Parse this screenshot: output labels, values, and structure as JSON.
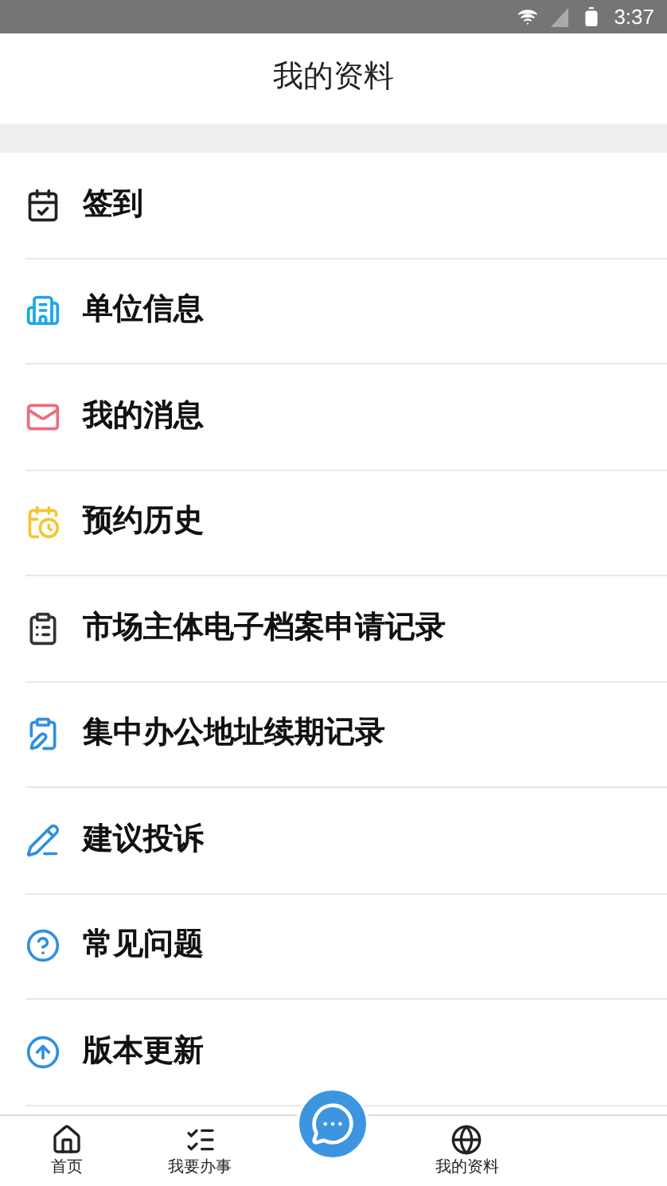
{
  "status_bar": {
    "time": "3:37"
  },
  "header": {
    "title": "我的资料"
  },
  "menu": [
    {
      "kind": "checkin",
      "label": "签到"
    },
    {
      "kind": "unit",
      "label": "单位信息"
    },
    {
      "kind": "mail",
      "label": "我的消息"
    },
    {
      "kind": "appointment",
      "label": "预约历史"
    },
    {
      "kind": "archive",
      "label": "市场主体电子档案申请记录"
    },
    {
      "kind": "renewal",
      "label": "集中办公地址续期记录"
    },
    {
      "kind": "feedback",
      "label": "建议投诉"
    },
    {
      "kind": "faq",
      "label": "常见问题"
    },
    {
      "kind": "update",
      "label": "版本更新"
    }
  ],
  "bottom_nav": [
    {
      "kind": "home",
      "label": "首页"
    },
    {
      "kind": "tasks",
      "label": "我要办事"
    },
    {
      "kind": "chat"
    },
    {
      "kind": "globe",
      "label": "我的资料"
    }
  ]
}
